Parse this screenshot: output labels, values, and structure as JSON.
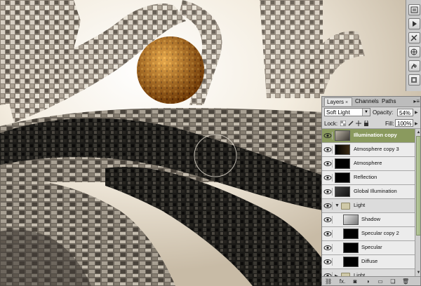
{
  "layers_panel": {
    "tabs": [
      {
        "label": "Layers",
        "active": true,
        "close": "×"
      },
      {
        "label": "Channels",
        "active": false
      },
      {
        "label": "Paths",
        "active": false
      }
    ],
    "menu_glyph": "▸≡",
    "blend_mode": "Soft Light",
    "opacity_label": "Opacity:",
    "opacity_value": "54%",
    "lock_label": "Lock:",
    "fill_label": "Fill:",
    "fill_value": "100%",
    "layers": [
      {
        "name": "Illumination copy",
        "selected": true
      },
      {
        "name": "Atmosphere copy 3",
        "selected": false
      },
      {
        "name": "Atmosphere",
        "selected": false
      },
      {
        "name": "Reflection",
        "selected": false
      },
      {
        "name": "Global Illumination",
        "selected": false
      },
      {
        "name": "Light",
        "group": true
      },
      {
        "name": "Shadow",
        "selected": false
      },
      {
        "name": "Specular copy 2",
        "selected": false
      },
      {
        "name": "Specular",
        "selected": false
      },
      {
        "name": "Diffuse",
        "selected": false
      },
      {
        "name": "Light",
        "group": true
      }
    ],
    "bottom_icons": [
      "link-icon",
      "fx-icon",
      "mask-icon",
      "adjustment-icon",
      "group-folder-icon",
      "new-layer-icon",
      "trash-icon"
    ],
    "bottom_glyphs": [
      "⛓",
      "fx.",
      "◙",
      "◑",
      "▭",
      "❏",
      "🗑"
    ]
  },
  "toolbar": {
    "icons": [
      "history-icon",
      "actions-icon",
      "tool-presets-icon",
      "navigator-icon",
      "info-icon",
      "brushes-icon"
    ]
  },
  "colors": {
    "selected_layer": "#8a9a5e",
    "panel_bg": "#d4d4d4",
    "scroll_accent": "#9bb07a"
  }
}
